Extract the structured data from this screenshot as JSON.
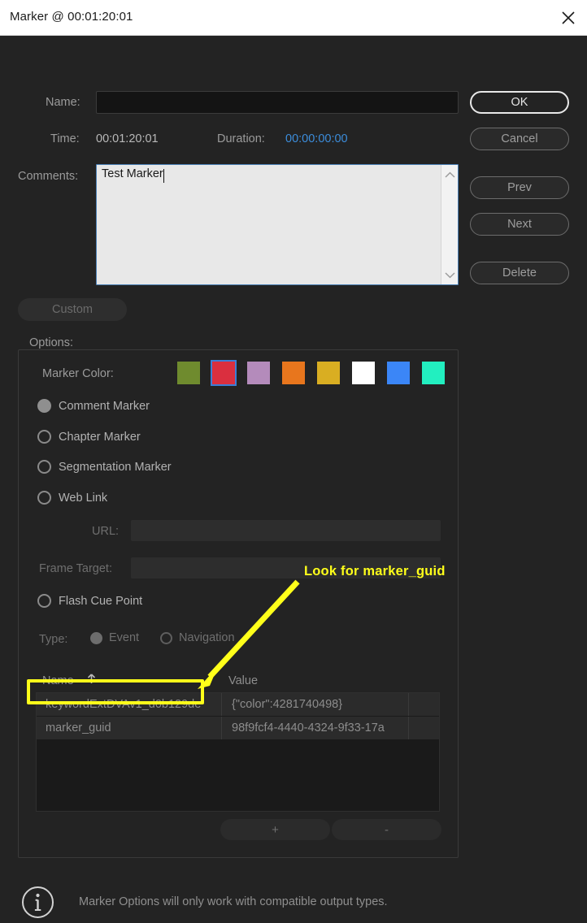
{
  "window": {
    "title": "Marker @ 00:01:20:01",
    "close_icon": "close-icon"
  },
  "form": {
    "name_label": "Name:",
    "name_value": "",
    "name_placeholder": "",
    "time_label": "Time:",
    "time_value": "00:01:20:01",
    "duration_label": "Duration:",
    "duration_value": "00:00:00:00",
    "duration_color": "#3c8ddb",
    "comments_label": "Comments:",
    "comments_value": "Test Marker",
    "scroll_up_icon": "chevron-up-icon",
    "scroll_down_icon": "chevron-down-icon"
  },
  "buttons": {
    "ok": "OK",
    "cancel": "Cancel",
    "prev": "Prev",
    "next": "Next",
    "delete": "Delete",
    "custom": "Custom",
    "add": "+",
    "remove": "-"
  },
  "options": {
    "legend": "Options:",
    "marker_color_label": "Marker Color:",
    "swatches": [
      {
        "name": "olive-green",
        "hex": "#6f8b2e",
        "selected": false
      },
      {
        "name": "red",
        "hex": "#da2f3f",
        "selected": true
      },
      {
        "name": "mauve",
        "hex": "#b48bbb",
        "selected": false
      },
      {
        "name": "orange",
        "hex": "#e8761d",
        "selected": false
      },
      {
        "name": "gold",
        "hex": "#d9ae22",
        "selected": false
      },
      {
        "name": "white",
        "hex": "#ffffff",
        "selected": false
      },
      {
        "name": "blue",
        "hex": "#3b86f7",
        "selected": false
      },
      {
        "name": "turquoise",
        "hex": "#22efc0",
        "selected": false
      }
    ],
    "marker_types": [
      {
        "label": "Comment Marker",
        "selected": true,
        "disabled": false
      },
      {
        "label": "Chapter Marker",
        "selected": false,
        "disabled": false
      },
      {
        "label": "Segmentation Marker",
        "selected": false,
        "disabled": false
      },
      {
        "label": "Web Link",
        "selected": false,
        "disabled": false
      }
    ],
    "url_label": "URL:",
    "url_value": "",
    "frame_target_label": "Frame Target:",
    "frame_target_value": "",
    "flash_cue_label": "Flash Cue Point",
    "flash_cue_selected": false,
    "type_label": "Type:",
    "type_options": [
      {
        "label": "Event",
        "selected": true
      },
      {
        "label": "Navigation",
        "selected": false
      }
    ]
  },
  "table": {
    "columns": [
      "Name",
      "Value"
    ],
    "sort_icon": "sort-ascending-arrow-icon",
    "sort_column": "Name",
    "rows": [
      {
        "name": "keywordExtDVAv1_d0b129de",
        "value": "{\"color\":4281740498}"
      },
      {
        "name": "marker_guid",
        "value": "98f9fcf4-4440-4324-9f33-17a"
      }
    ]
  },
  "footer": {
    "info_icon": "info-circle-icon",
    "text": "Marker Options will only work with compatible output types."
  },
  "annotation": {
    "text": "Look for marker_guid",
    "color": "#ffff1a",
    "arrow": "arrow-pointing-down-left",
    "highlight_target": "marker_guid"
  }
}
